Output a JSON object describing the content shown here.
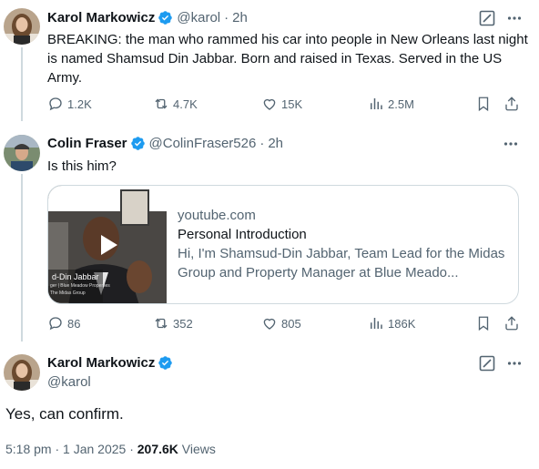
{
  "tweet1": {
    "name": "Karol Markowicz",
    "handle": "@karol",
    "time": "2h",
    "text": "BREAKING: the man who rammed his car into people in New Orleans last night is named Shamsud Din Jabbar. Born and raised in Texas. Served in the US Army.",
    "stats": {
      "replies": "1.2K",
      "reposts": "4.7K",
      "likes": "15K",
      "views": "2.5M"
    }
  },
  "tweet2": {
    "name": "Colin Fraser",
    "handle": "@ColinFraser526",
    "time": "2h",
    "text": "Is this him?",
    "card": {
      "domain": "youtube.com",
      "title": "Personal Introduction",
      "description": "Hi, I'm Shamsud-Din Jabbar, Team Lead for the Midas Group and Property Manager at Blue Meado...",
      "thumb_caption": "d-Din Jabbar",
      "thumb_subcaption": "ger | Blue Meadow Properties",
      "thumb_subcaption2": "The Midas Group"
    },
    "stats": {
      "replies": "86",
      "reposts": "352",
      "likes": "805",
      "views": "186K"
    }
  },
  "tweet3": {
    "name": "Karol Markowicz",
    "handle": "@karol",
    "text": "Yes, can confirm.",
    "posted": "5:18 pm · 1 Jan 2025 · ",
    "views_count": "207.6K",
    "views_label": " Views"
  },
  "colors": {
    "verified": "#1d9bf0",
    "muted": "#536471",
    "text": "#0f1419",
    "border": "#cfd9de"
  },
  "icons": [
    "verified-icon",
    "grok-icon",
    "more-icon",
    "reply-icon",
    "repost-icon",
    "like-icon",
    "views-icon",
    "bookmark-icon",
    "share-icon",
    "play-icon"
  ]
}
